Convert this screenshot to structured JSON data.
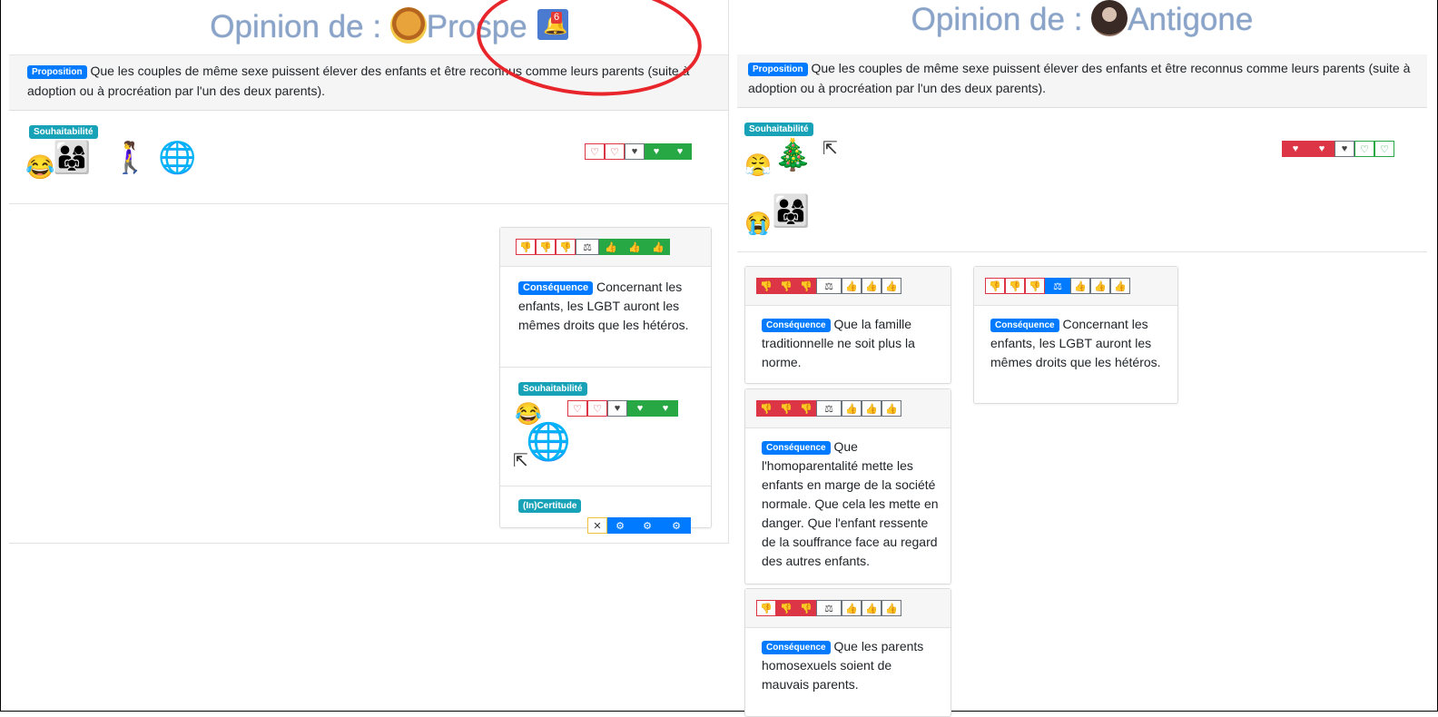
{
  "left": {
    "title": "Opinion de :",
    "username": "Prospe",
    "notification_count": "6",
    "proposition_badge": "Proposition",
    "proposition_text": "Que les couples de même sexe puissent élever des enfants et être reconnus comme leurs parents (suite à adoption ou à procréation par l'un des deux parents).",
    "desirability_badge": "Souhaitabilité",
    "card": {
      "badge": "Conséquence",
      "text": "Concernant les enfants, les LGBT auront les mêmes droits que les hétéros.",
      "desirability_badge": "Souhaitabilité",
      "certainty_badge": "(In)Certitude"
    }
  },
  "right": {
    "title": "Opinion de :",
    "username": "Antigone",
    "proposition_badge": "Proposition",
    "proposition_text": "Que les couples de même sexe puissent élever des enfants et être reconnus comme leurs parents (suite à adoption ou à procréation par l'un des deux parents).",
    "desirability_badge": "Souhaitabilité",
    "cards": [
      {
        "badge": "Conséquence",
        "text": "Que la famille traditionnelle ne soit plus la norme."
      },
      {
        "badge": "Conséquence",
        "text": "Que l'homoparentalité mette les enfants en marge de la société normale. Que cela les mette en danger. Que l'enfant ressente de la souffrance face au regard des autres enfants."
      },
      {
        "badge": "Conséquence",
        "text": "Que les parents homosexuels soient de mauvais parents."
      },
      {
        "badge": "Conséquence",
        "text": "Concernant les enfants, les LGBT auront les mêmes droits que les hétéros."
      }
    ]
  },
  "icons": [
    "heart-icon",
    "thumbs-down-icon",
    "thumbs-up-icon",
    "scale-icon",
    "cogs-icon",
    "close-icon",
    "bell-icon",
    "cursor-icon"
  ],
  "colors": {
    "title": "#8aa4c9",
    "badge_blue": "#007bff",
    "badge_teal": "#17a2b8",
    "red": "#dc3545",
    "green": "#28a745",
    "annotation": "#e8252b"
  }
}
